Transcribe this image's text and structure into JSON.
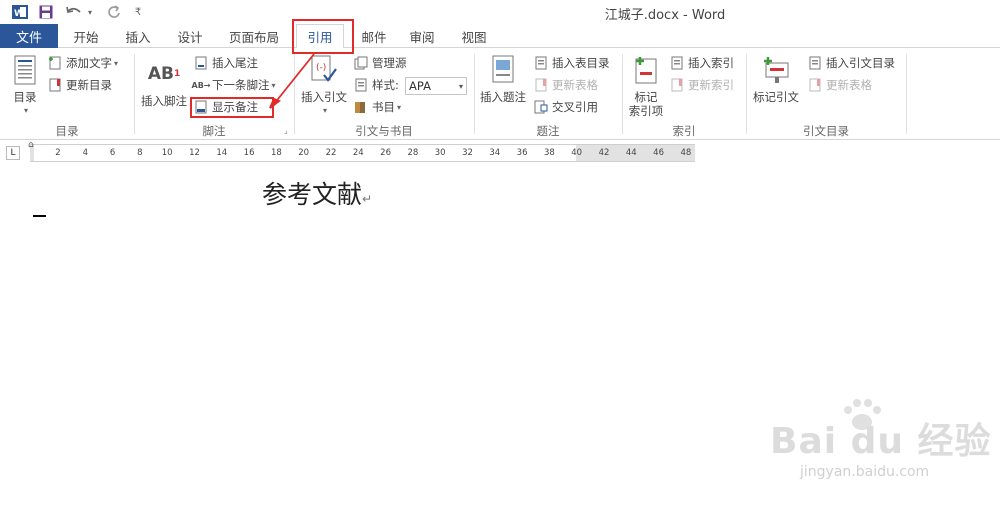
{
  "window": {
    "title": "江城子.docx - Word"
  },
  "qat": {
    "word_icon": "word-logo-icon",
    "save_icon": "save-icon",
    "undo_icon": "undo-icon",
    "redo_icon": "redo-icon",
    "customize_icon": "customize-qat-icon"
  },
  "tabs": {
    "file": "文件",
    "items": [
      "开始",
      "插入",
      "设计",
      "页面布局",
      "引用",
      "邮件",
      "审阅",
      "视图"
    ],
    "active": "引用"
  },
  "ribbon": {
    "toc": {
      "group_label": "目录",
      "toc_button": "目录",
      "add_text": "添加文字",
      "update_toc": "更新目录"
    },
    "footnotes": {
      "group_label": "脚注",
      "insert_footnote_line1": "AB",
      "insert_footnote_sup": "1",
      "insert_footnote": "插入脚注",
      "insert_endnote": "插入尾注",
      "next_footnote": "下一条脚注",
      "show_notes": "显示备注"
    },
    "citations": {
      "group_label": "引文与书目",
      "insert_citation": "插入引文",
      "manage_sources": "管理源",
      "style_label": "样式:",
      "style_value": "APA",
      "bibliography": "书目"
    },
    "captions": {
      "group_label": "题注",
      "insert_caption": "插入题注",
      "insert_table_of_figures": "插入表目录",
      "update_table": "更新表格",
      "cross_reference": "交叉引用"
    },
    "index": {
      "group_label": "索引",
      "mark_entry_line1": "标记",
      "mark_entry_line2": "索引项",
      "insert_index": "插入索引",
      "update_index": "更新索引"
    },
    "toa": {
      "group_label": "引文目录",
      "mark_citation": "标记引文",
      "insert_toa": "插入引文目录",
      "update_table": "更新表格"
    }
  },
  "ruler": {
    "corner_symbol": "L",
    "ticks": [
      "2",
      "4",
      "6",
      "8",
      "10",
      "12",
      "14",
      "16",
      "18",
      "20",
      "22",
      "24",
      "26",
      "28",
      "30",
      "32",
      "34",
      "36",
      "38",
      "40",
      "42",
      "44",
      "46",
      "48"
    ]
  },
  "document": {
    "heading": "参考文献",
    "paragraph_mark": "↵"
  },
  "watermark": {
    "text": "Bai du 经验",
    "url": "jingyan.baidu.com"
  },
  "colors": {
    "file_tab": "#2b579a",
    "highlight_red": "#e02b2b"
  }
}
